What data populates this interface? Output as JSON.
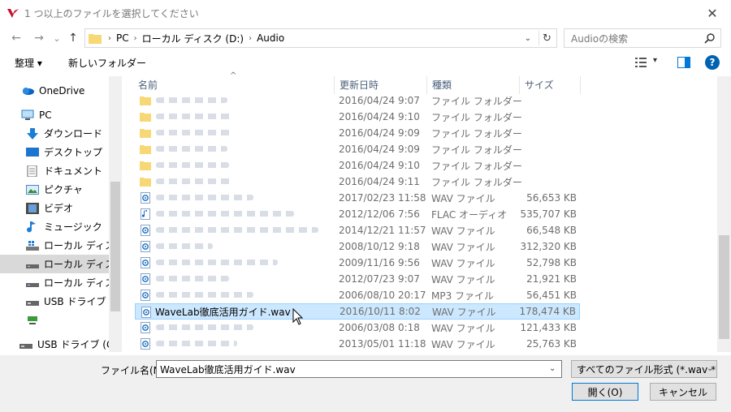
{
  "window": {
    "title": "1 つ以上のファイルを選択してください",
    "close_glyph": "✕"
  },
  "nav": {
    "back_glyph": "←",
    "forward_glyph": "→",
    "recent_glyph": "⌄",
    "up_glyph": "↑",
    "breadcrumbs": [
      "PC",
      "ローカル ディスク (D:)",
      "Audio"
    ],
    "search_placeholder": "Audioの検索"
  },
  "toolbar": {
    "organize_label": "整理 ▾",
    "new_folder_label": "新しいフォルダー",
    "view_dd_glyph": "▾",
    "help_glyph": "?"
  },
  "sidebar": {
    "items": [
      {
        "label": "OneDrive",
        "icon": "cloud-icon"
      },
      {
        "label": "PC",
        "icon": "computer-icon"
      },
      {
        "label": "ダウンロード",
        "icon": "download-icon"
      },
      {
        "label": "デスクトップ",
        "icon": "desktop-icon"
      },
      {
        "label": "ドキュメント",
        "icon": "document-icon"
      },
      {
        "label": "ピクチャ",
        "icon": "picture-icon"
      },
      {
        "label": "ビデオ",
        "icon": "video-icon"
      },
      {
        "label": "ミュージック",
        "icon": "music-icon"
      },
      {
        "label": "ローカル ディスク (C",
        "icon": "drive-icon"
      },
      {
        "label": "ローカル ディスク (D",
        "icon": "drive-icon"
      },
      {
        "label": "ローカル ディスク (F",
        "icon": "drive-icon"
      },
      {
        "label": "USB ドライブ (G:)",
        "icon": "usb-drive-icon"
      },
      {
        "label": "",
        "icon": "network-icon"
      },
      {
        "label": "USB ドライブ (G:)",
        "icon": "usb-drive-icon"
      }
    ]
  },
  "columns": {
    "name": "名前",
    "modified": "更新日時",
    "type": "種類",
    "size": "サイズ",
    "sort_glyph": "^"
  },
  "files": [
    {
      "name": "",
      "date": "2016/04/24 9:07",
      "type": "ファイル フォルダー",
      "size": "",
      "icon": "folder"
    },
    {
      "name": "",
      "date": "2016/04/24 9:10",
      "type": "ファイル フォルダー",
      "size": "",
      "icon": "folder"
    },
    {
      "name": "",
      "date": "2016/04/24 9:09",
      "type": "ファイル フォルダー",
      "size": "",
      "icon": "folder"
    },
    {
      "name": "",
      "date": "2016/04/24 9:09",
      "type": "ファイル フォルダー",
      "size": "",
      "icon": "folder"
    },
    {
      "name": "",
      "date": "2016/04/24 9:10",
      "type": "ファイル フォルダー",
      "size": "",
      "icon": "folder"
    },
    {
      "name": "",
      "date": "2016/04/24 9:11",
      "type": "ファイル フォルダー",
      "size": "",
      "icon": "folder"
    },
    {
      "name": "",
      "date": "2017/02/23 11:58",
      "type": "WAV ファイル",
      "size": "56,653 KB",
      "icon": "wav"
    },
    {
      "name": "",
      "date": "2012/12/06 7:56",
      "type": "FLAC オーディオ",
      "size": "535,707 KB",
      "icon": "flac"
    },
    {
      "name": "",
      "date": "2014/12/21 11:57",
      "type": "WAV ファイル",
      "size": "66,548 KB",
      "icon": "wav"
    },
    {
      "name": "",
      "date": "2008/10/12 9:18",
      "type": "WAV ファイル",
      "size": "312,320 KB",
      "icon": "wav"
    },
    {
      "name": "",
      "date": "2009/11/16 9:56",
      "type": "WAV ファイル",
      "size": "52,798 KB",
      "icon": "wav"
    },
    {
      "name": "",
      "date": "2012/07/23 9:07",
      "type": "WAV ファイル",
      "size": "21,921 KB",
      "icon": "wav"
    },
    {
      "name": "",
      "date": "2006/08/10 20:17",
      "type": "MP3 ファイル",
      "size": "56,451 KB",
      "icon": "wav"
    },
    {
      "name": "WaveLab徹底活用ガイド.wav",
      "date": "2016/10/11 8:02",
      "type": "WAV ファイル",
      "size": "178,474 KB",
      "icon": "wav",
      "selected": true
    },
    {
      "name": "",
      "date": "2006/03/08 0:18",
      "type": "WAV ファイル",
      "size": "121,433 KB",
      "icon": "wav"
    },
    {
      "name": "",
      "date": "2013/05/01 11:18",
      "type": "WAV ファイル",
      "size": "25,763 KB",
      "icon": "wav"
    }
  ],
  "footer": {
    "filename_label": "ファイル名(N):",
    "filename_value": "WaveLab徹底活用ガイド.wav",
    "filter_value": "すべてのファイル形式 (*.wav *.aif *",
    "dd_glyph": "⌄",
    "open_label": "開く(O)",
    "cancel_label": "キャンセル"
  },
  "colors": {
    "selection_bg": "#cce8ff",
    "selection_border": "#99d1ff",
    "folder": "#f8d775",
    "accent": "#0078d7"
  }
}
